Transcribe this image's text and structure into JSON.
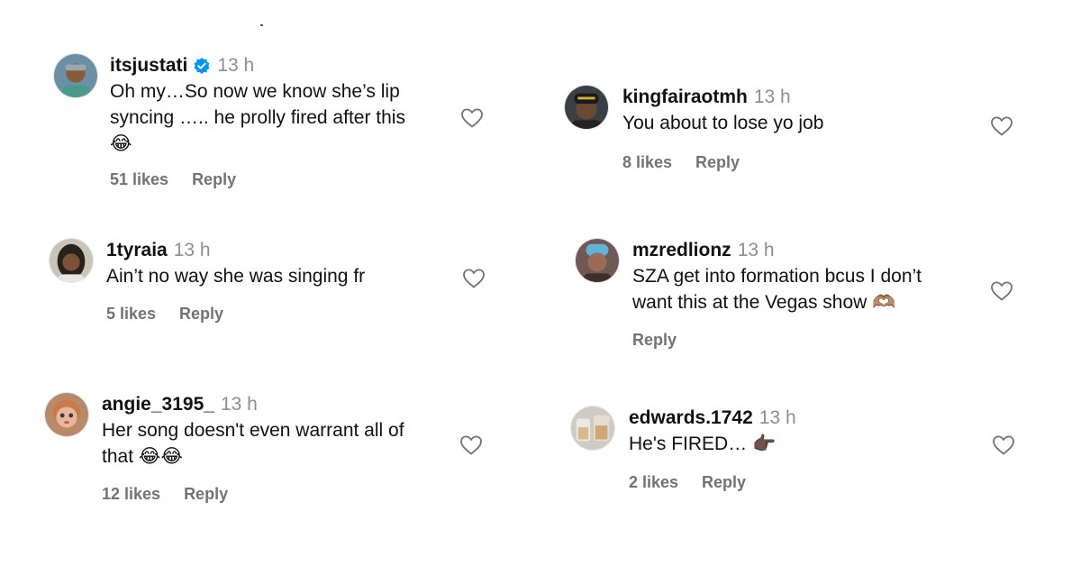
{
  "comments": [
    {
      "username": "itsjustati",
      "verified": true,
      "time": "13 h",
      "text": "Oh my…So now we know she’s lip\nsyncing ….. he prolly fired after this\n😂",
      "likes": "51 likes",
      "reply": "Reply"
    },
    {
      "username": "kingfairaotmh",
      "time": "13 h",
      "text": "You about to lose yo job",
      "likes": "8 likes",
      "reply": "Reply"
    },
    {
      "username": "1tyraia",
      "time": "13 h",
      "text": "Ain’t no way she was singing fr",
      "likes": "5 likes",
      "reply": "Reply"
    },
    {
      "username": "mzredlionz",
      "time": "13 h",
      "text": "SZA get into formation bcus I don’t\nwant this at the Vegas show 🫶🏽",
      "reply": "Reply"
    },
    {
      "username": "angie_3195_",
      "time": "13 h",
      "text": "Her song doesn't even warrant all of\nthat 😂😂",
      "likes": "12 likes",
      "reply": "Reply"
    },
    {
      "username": "edwards.1742",
      "time": "13 h",
      "text": "He's FIRED… 👉🏿",
      "likes": "2 likes",
      "reply": "Reply"
    }
  ],
  "icons": {
    "like": "heart-outline-icon",
    "verified": "verified-badge-icon"
  },
  "colors": {
    "verified": "#0095f6",
    "secondary_text": "#737373",
    "time": "#8e8e8e"
  }
}
